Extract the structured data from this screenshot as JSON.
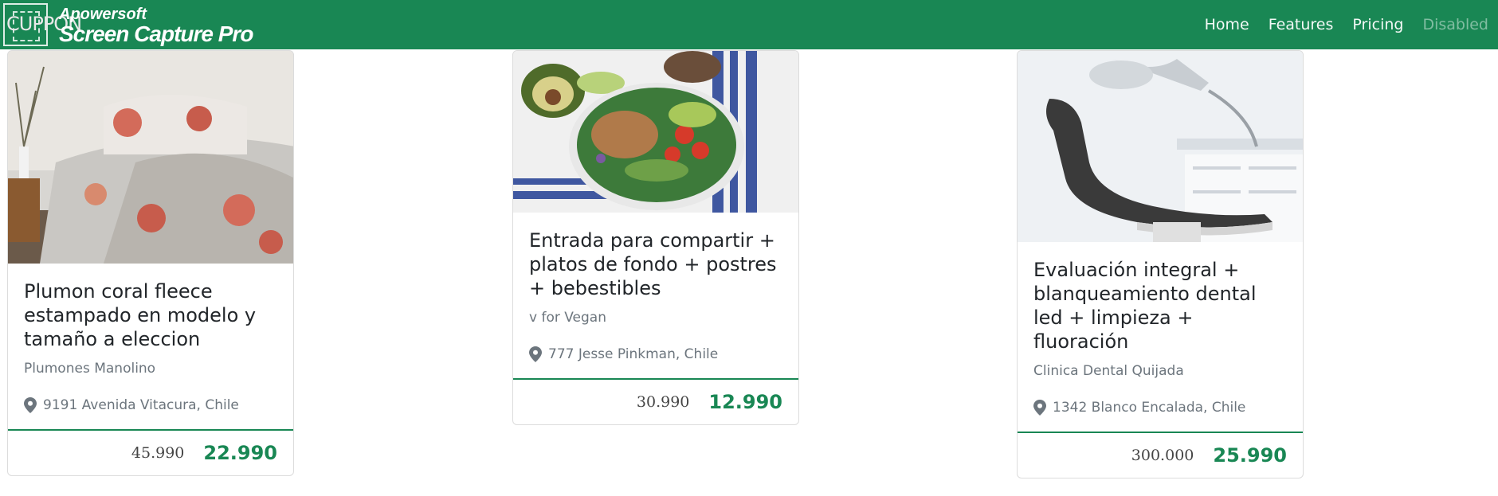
{
  "brand": {
    "logo_text": "CUPPON",
    "watermark_line1": "Apowersoft",
    "watermark_line2": "Screen Capture Pro"
  },
  "nav": {
    "home": "Home",
    "features": "Features",
    "pricing": "Pricing",
    "disabled": "Disabled"
  },
  "colors": {
    "primary": "#198754",
    "muted": "#6c757d"
  },
  "cards": [
    {
      "title": "Plumon coral fleece estampado en modelo y tamaño a eleccion",
      "merchant": "Plumones Manolino",
      "location": "9191 Avenida Vitacura, Chile",
      "old_price": "45.990",
      "new_price": "22.990",
      "image": "bedding-photo"
    },
    {
      "title": "Entrada para compartir + platos de fondo + postres + bebestibles",
      "merchant": "v for Vegan",
      "location": "777 Jesse Pinkman, Chile",
      "old_price": "30.990",
      "new_price": "12.990",
      "image": "salad-bowl-photo"
    },
    {
      "title": "Evaluación integral + blanqueamiento dental led + limpieza + fluoración",
      "merchant": "Clinica Dental Quijada",
      "location": "1342 Blanco Encalada, Chile",
      "old_price": "300.000",
      "new_price": "25.990",
      "image": "dental-chair-photo"
    }
  ]
}
